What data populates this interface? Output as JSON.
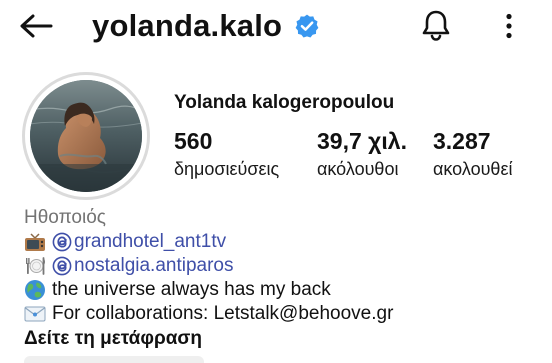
{
  "header": {
    "username": "yolanda.kalo",
    "verified": true,
    "icons": {
      "back": "back-arrow-icon",
      "verified": "verified-badge-icon",
      "notifications": "bell-icon",
      "more": "more-vertical-icon"
    },
    "accent_color": "#3897f0"
  },
  "profile": {
    "full_name": "Yolanda kalogeropoulou",
    "stats": {
      "posts": {
        "value": "560",
        "label": "δημοσιεύσεις"
      },
      "followers": {
        "value": "39,7 χιλ.",
        "label": "ακόλουθοι"
      },
      "following": {
        "value": "3.287",
        "label": "ακολουθεί"
      }
    }
  },
  "bio": {
    "category": "Ηθοποιός",
    "lines": [
      {
        "icon": "tv-icon",
        "mention": "grandhotel_ant1tv"
      },
      {
        "icon": "plate-icon",
        "mention": "nostalgia.antiparos"
      },
      {
        "icon": "globe-icon",
        "text": "the universe always has my back"
      },
      {
        "icon": "envelope-icon",
        "text": "For collaborations: Letstalk@behoove.gr"
      }
    ],
    "mention_color": "#3f4fa8",
    "see_translation": "Δείτε τη μετάφραση"
  }
}
